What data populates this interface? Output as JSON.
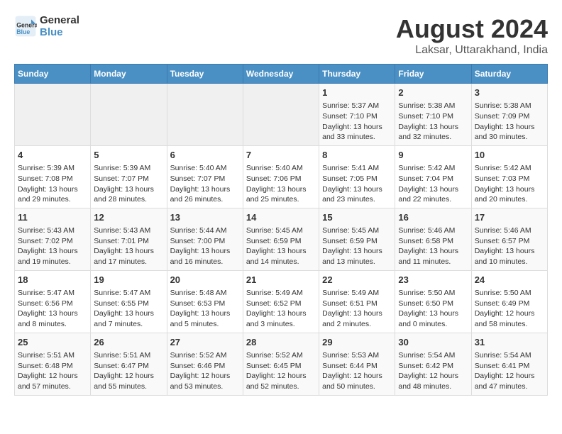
{
  "logo": {
    "line1": "General",
    "line2": "Blue"
  },
  "title": "August 2024",
  "subtitle": "Laksar, Uttarakhand, India",
  "days_of_week": [
    "Sunday",
    "Monday",
    "Tuesday",
    "Wednesday",
    "Thursday",
    "Friday",
    "Saturday"
  ],
  "weeks": [
    [
      {
        "day": "",
        "info": ""
      },
      {
        "day": "",
        "info": ""
      },
      {
        "day": "",
        "info": ""
      },
      {
        "day": "",
        "info": ""
      },
      {
        "day": "1",
        "info": "Sunrise: 5:37 AM\nSunset: 7:10 PM\nDaylight: 13 hours\nand 33 minutes."
      },
      {
        "day": "2",
        "info": "Sunrise: 5:38 AM\nSunset: 7:10 PM\nDaylight: 13 hours\nand 32 minutes."
      },
      {
        "day": "3",
        "info": "Sunrise: 5:38 AM\nSunset: 7:09 PM\nDaylight: 13 hours\nand 30 minutes."
      }
    ],
    [
      {
        "day": "4",
        "info": "Sunrise: 5:39 AM\nSunset: 7:08 PM\nDaylight: 13 hours\nand 29 minutes."
      },
      {
        "day": "5",
        "info": "Sunrise: 5:39 AM\nSunset: 7:07 PM\nDaylight: 13 hours\nand 28 minutes."
      },
      {
        "day": "6",
        "info": "Sunrise: 5:40 AM\nSunset: 7:07 PM\nDaylight: 13 hours\nand 26 minutes."
      },
      {
        "day": "7",
        "info": "Sunrise: 5:40 AM\nSunset: 7:06 PM\nDaylight: 13 hours\nand 25 minutes."
      },
      {
        "day": "8",
        "info": "Sunrise: 5:41 AM\nSunset: 7:05 PM\nDaylight: 13 hours\nand 23 minutes."
      },
      {
        "day": "9",
        "info": "Sunrise: 5:42 AM\nSunset: 7:04 PM\nDaylight: 13 hours\nand 22 minutes."
      },
      {
        "day": "10",
        "info": "Sunrise: 5:42 AM\nSunset: 7:03 PM\nDaylight: 13 hours\nand 20 minutes."
      }
    ],
    [
      {
        "day": "11",
        "info": "Sunrise: 5:43 AM\nSunset: 7:02 PM\nDaylight: 13 hours\nand 19 minutes."
      },
      {
        "day": "12",
        "info": "Sunrise: 5:43 AM\nSunset: 7:01 PM\nDaylight: 13 hours\nand 17 minutes."
      },
      {
        "day": "13",
        "info": "Sunrise: 5:44 AM\nSunset: 7:00 PM\nDaylight: 13 hours\nand 16 minutes."
      },
      {
        "day": "14",
        "info": "Sunrise: 5:45 AM\nSunset: 6:59 PM\nDaylight: 13 hours\nand 14 minutes."
      },
      {
        "day": "15",
        "info": "Sunrise: 5:45 AM\nSunset: 6:59 PM\nDaylight: 13 hours\nand 13 minutes."
      },
      {
        "day": "16",
        "info": "Sunrise: 5:46 AM\nSunset: 6:58 PM\nDaylight: 13 hours\nand 11 minutes."
      },
      {
        "day": "17",
        "info": "Sunrise: 5:46 AM\nSunset: 6:57 PM\nDaylight: 13 hours\nand 10 minutes."
      }
    ],
    [
      {
        "day": "18",
        "info": "Sunrise: 5:47 AM\nSunset: 6:56 PM\nDaylight: 13 hours\nand 8 minutes."
      },
      {
        "day": "19",
        "info": "Sunrise: 5:47 AM\nSunset: 6:55 PM\nDaylight: 13 hours\nand 7 minutes."
      },
      {
        "day": "20",
        "info": "Sunrise: 5:48 AM\nSunset: 6:53 PM\nDaylight: 13 hours\nand 5 minutes."
      },
      {
        "day": "21",
        "info": "Sunrise: 5:49 AM\nSunset: 6:52 PM\nDaylight: 13 hours\nand 3 minutes."
      },
      {
        "day": "22",
        "info": "Sunrise: 5:49 AM\nSunset: 6:51 PM\nDaylight: 13 hours\nand 2 minutes."
      },
      {
        "day": "23",
        "info": "Sunrise: 5:50 AM\nSunset: 6:50 PM\nDaylight: 13 hours\nand 0 minutes."
      },
      {
        "day": "24",
        "info": "Sunrise: 5:50 AM\nSunset: 6:49 PM\nDaylight: 12 hours\nand 58 minutes."
      }
    ],
    [
      {
        "day": "25",
        "info": "Sunrise: 5:51 AM\nSunset: 6:48 PM\nDaylight: 12 hours\nand 57 minutes."
      },
      {
        "day": "26",
        "info": "Sunrise: 5:51 AM\nSunset: 6:47 PM\nDaylight: 12 hours\nand 55 minutes."
      },
      {
        "day": "27",
        "info": "Sunrise: 5:52 AM\nSunset: 6:46 PM\nDaylight: 12 hours\nand 53 minutes."
      },
      {
        "day": "28",
        "info": "Sunrise: 5:52 AM\nSunset: 6:45 PM\nDaylight: 12 hours\nand 52 minutes."
      },
      {
        "day": "29",
        "info": "Sunrise: 5:53 AM\nSunset: 6:44 PM\nDaylight: 12 hours\nand 50 minutes."
      },
      {
        "day": "30",
        "info": "Sunrise: 5:54 AM\nSunset: 6:42 PM\nDaylight: 12 hours\nand 48 minutes."
      },
      {
        "day": "31",
        "info": "Sunrise: 5:54 AM\nSunset: 6:41 PM\nDaylight: 12 hours\nand 47 minutes."
      }
    ]
  ]
}
